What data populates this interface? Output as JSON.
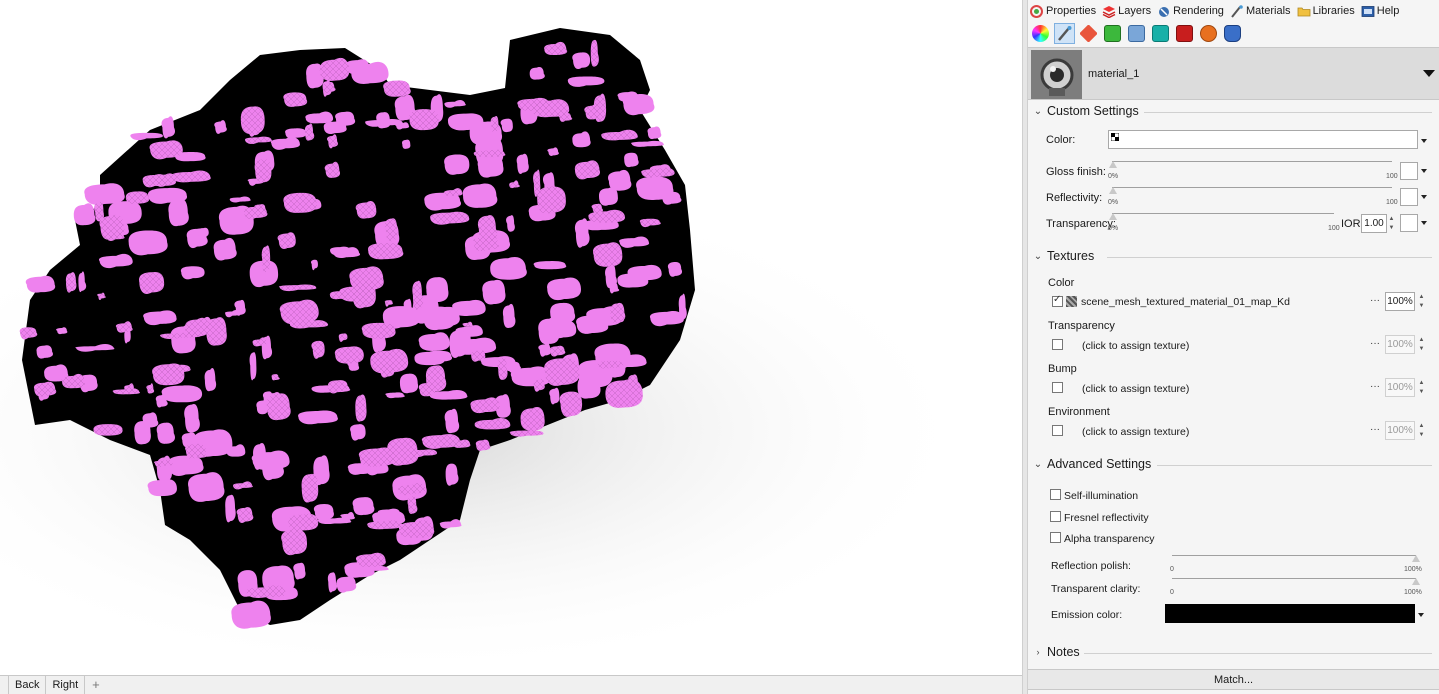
{
  "viewport": {
    "tabs": [
      "Back",
      "Right"
    ],
    "add_tab_symbol": "+"
  },
  "panel_tabs": [
    {
      "label": "Properties",
      "icon": "properties-icon"
    },
    {
      "label": "Layers",
      "icon": "layers-icon"
    },
    {
      "label": "Rendering",
      "icon": "rendering-icon"
    },
    {
      "label": "Materials",
      "icon": "materials-icon"
    },
    {
      "label": "Libraries",
      "icon": "libraries-icon"
    },
    {
      "label": "Help",
      "icon": "help-icon"
    }
  ],
  "toolbar_icons": [
    "color-wheel-icon",
    "material-brush-icon",
    "dimension-icon",
    "surface-icon",
    "mesh-icon",
    "object-icon",
    "page-icon",
    "texture-icon",
    "cylinder-icon"
  ],
  "material": {
    "name": "material_1"
  },
  "custom_settings": {
    "title": "Custom Settings",
    "color_label": "Color:",
    "gloss_label": "Gloss finish:",
    "reflectivity_label": "Reflectivity:",
    "transparency_label": "Transparency:",
    "min_label": "0%",
    "max_label": "100",
    "ior_label": "IOR:",
    "ior_value": "1.00"
  },
  "textures": {
    "title": "Textures",
    "color_label": "Color",
    "color_texture": "scene_mesh_textured_material_01_map_Kd",
    "color_amount": "100%",
    "transparency_label": "Transparency",
    "bump_label": "Bump",
    "environment_label": "Environment",
    "assign_placeholder": "(click to assign texture)",
    "disabled_amount": "100%",
    "dots": "···"
  },
  "advanced_settings": {
    "title": "Advanced Settings",
    "self_illumination": "Self-illumination",
    "fresnel": "Fresnel reflectivity",
    "alpha": "Alpha transparency",
    "reflection_polish": "Reflection polish:",
    "transparent_clarity": "Transparent clarity:",
    "min_label": "0",
    "max_label": "100%",
    "emission_color_label": "Emission color:",
    "emission_color": "#000000"
  },
  "notes": {
    "title": "Notes"
  },
  "match_button": "Match...",
  "colors": {
    "mesh_pink": "#ee82ee",
    "mesh_black": "#000000"
  }
}
